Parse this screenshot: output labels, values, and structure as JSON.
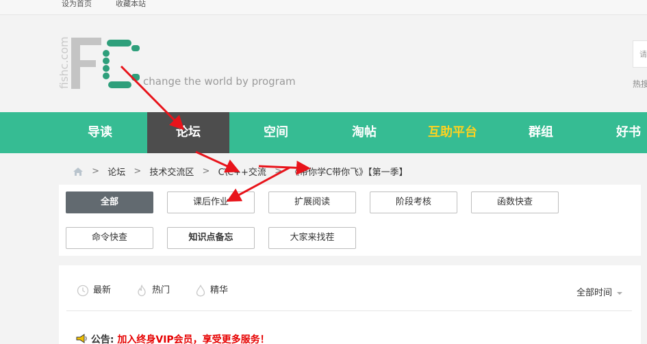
{
  "topbar": {
    "set_home": "设为首页",
    "bookmark": "收藏本站"
  },
  "header": {
    "logo_side_text": "fishc.com",
    "slogan": "change the world by program",
    "search_placeholder": "请",
    "hot_label": "热搜"
  },
  "nav": {
    "items": [
      {
        "label": "导读"
      },
      {
        "label": "论坛"
      },
      {
        "label": "空间"
      },
      {
        "label": "淘帖"
      },
      {
        "label": "互助平台"
      },
      {
        "label": "群组"
      },
      {
        "label": "好书"
      }
    ],
    "active_color": "#4d4d4d",
    "bar_color": "#36bc93",
    "help_color": "#ffd21f"
  },
  "breadcrumb": {
    "items": [
      "论坛",
      "技术交流区",
      "C\\C++交流",
      "《带你学C带你飞》【第一季】"
    ]
  },
  "filters": {
    "buttons": [
      "全部",
      "课后作业",
      "扩展阅读",
      "阶段考核",
      "函数快查",
      "命令快查",
      "知识点备忘",
      "大家来找茬"
    ],
    "active_index": 0
  },
  "list": {
    "tabs": [
      "最新",
      "热门",
      "精华"
    ],
    "time_filter": "全部时间",
    "notice_label": "公告:",
    "notice_text": "加入终身VIP会员，享受更多服务！",
    "notice_color": "#e60000"
  },
  "annotation_color": "#e8141b"
}
